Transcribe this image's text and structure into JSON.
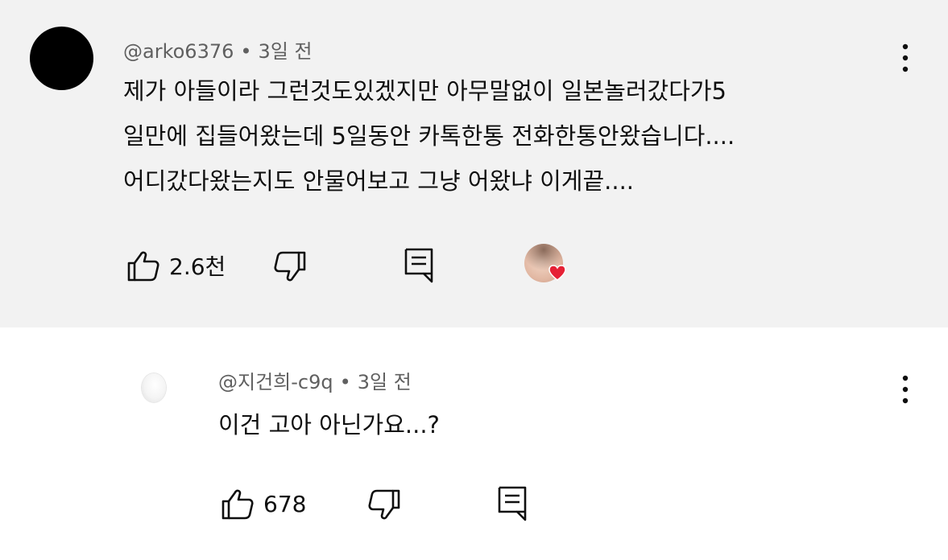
{
  "main_comment": {
    "author": "@arko6376",
    "separator": "•",
    "time": "3일 전",
    "lines": [
      "제가 아들이라 그런것도있겠지만 아무말없이 일본놀러갔다가5",
      "일만에 집들어왔는데 5일동안 카톡한통 전화한통안왔습니다....",
      "어디갔다왔는지도 안물어보고 그냥 어왔냐 이게끝...."
    ],
    "likes": "2.6천",
    "icons": {
      "like": "thumbs-up-icon",
      "dislike": "thumbs-down-icon",
      "reply": "reply-icon",
      "more": "more-vertical-icon",
      "creator_heart": "creator-heart-icon"
    },
    "heart_color": "#e62135",
    "background": "#f2f2f2"
  },
  "reply_comment": {
    "author": "@지건희-c9q",
    "separator": "•",
    "time": "3일 전",
    "text": "이건 고아 아닌가요...?",
    "likes": "678"
  }
}
